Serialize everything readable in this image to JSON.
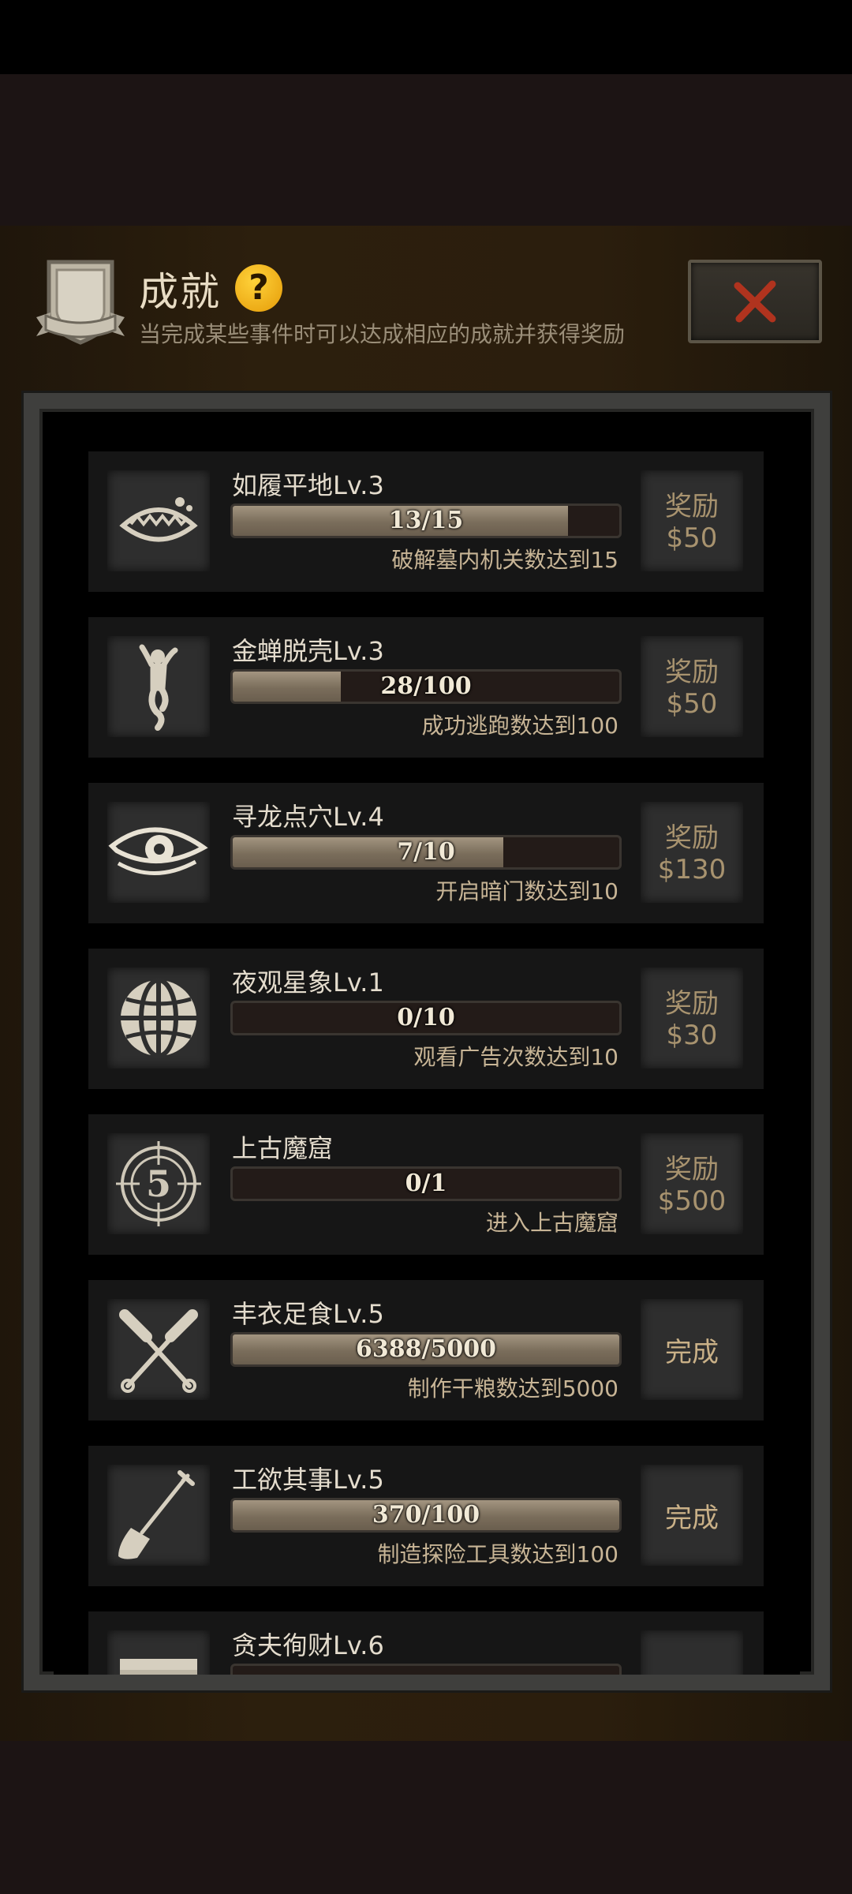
{
  "header": {
    "title": "成就",
    "help_label": "?",
    "subtitle": "当完成某些事件时可以达成相应的成就并获得奖励"
  },
  "colors": {
    "accent_gold": "#e59b08",
    "card_bg": "#161616",
    "reward_text": "#a8936f",
    "close_x": "#b0331e"
  },
  "achievements": [
    {
      "name": "如履平地Lv.3",
      "progress_text": "13/15",
      "progress": 0.867,
      "desc": "破解墓内机关数达到15",
      "reward_label": "奖励",
      "reward_value": "$50",
      "icon": "trap-icon",
      "done": false
    },
    {
      "name": "金蝉脱壳Lv.3",
      "progress_text": "28/100",
      "progress": 0.28,
      "desc": "成功逃跑数达到100",
      "reward_label": "奖励",
      "reward_value": "$50",
      "icon": "escape-figure-icon",
      "done": false
    },
    {
      "name": "寻龙点穴Lv.4",
      "progress_text": "7/10",
      "progress": 0.7,
      "desc": "开启暗门数达到10",
      "reward_label": "奖励",
      "reward_value": "$130",
      "icon": "eye-icon",
      "done": false
    },
    {
      "name": "夜观星象Lv.1",
      "progress_text": "0/10",
      "progress": 0,
      "desc": "观看广告次数达到10",
      "reward_label": "奖励",
      "reward_value": "$30",
      "icon": "globe-icon",
      "done": false
    },
    {
      "name": "上古魔窟",
      "progress_text": "0/1",
      "progress": 0,
      "desc": "进入上古魔窟",
      "reward_label": "奖励",
      "reward_value": "$500",
      "icon": "countdown-5-icon",
      "done": false
    },
    {
      "name": "丰衣足食Lv.5",
      "progress_text": "6388/5000",
      "progress": 1,
      "desc": "制作干粮数达到5000",
      "reward_label": "完成",
      "reward_value": "",
      "icon": "crossed-spatulas-icon",
      "done": true
    },
    {
      "name": "工欲其事Lv.5",
      "progress_text": "370/100",
      "progress": 1,
      "desc": "制造探险工具数达到100",
      "reward_label": "完成",
      "reward_value": "",
      "icon": "shovel-icon",
      "done": true
    },
    {
      "name": "贪夫徇财Lv.6",
      "progress_text": "",
      "progress": 0,
      "desc": "",
      "reward_label": "",
      "reward_value": "",
      "icon": "treasure-icon",
      "done": false
    }
  ]
}
